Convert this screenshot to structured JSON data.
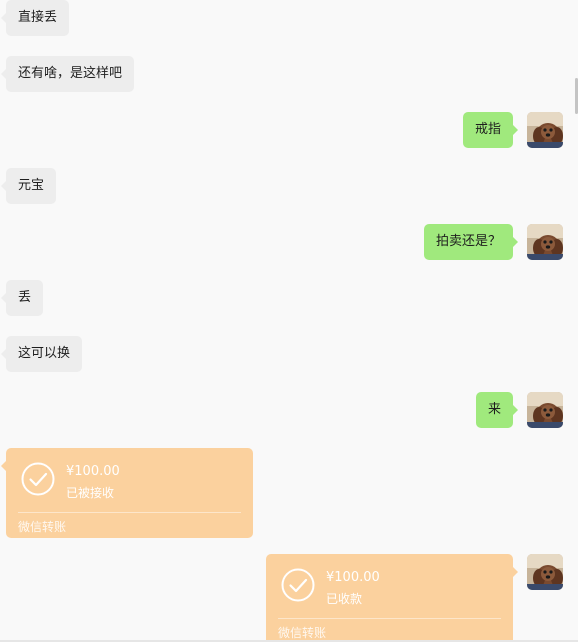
{
  "messages": {
    "m1": "直接丢",
    "m2": "还有啥，是这样吧",
    "m3": "戒指",
    "m4": "元宝",
    "m5": "拍卖还是？",
    "m6": "丢",
    "m7": "这可以换",
    "m8": "来"
  },
  "transfers": {
    "received": {
      "amount": "¥100.00",
      "status": "已被接收",
      "brand": "微信转账"
    },
    "sent": {
      "amount": "¥100.00",
      "status": "已收款",
      "brand": "微信转账"
    }
  },
  "icons": {
    "avatar": "dog-avatar-icon",
    "transfer_check": "check-circle-icon"
  },
  "colors": {
    "background": "#f9f9f9",
    "incoming_bubble": "#ededed",
    "outgoing_bubble": "#a0e97d",
    "transfer_card": "#fbd19e"
  }
}
